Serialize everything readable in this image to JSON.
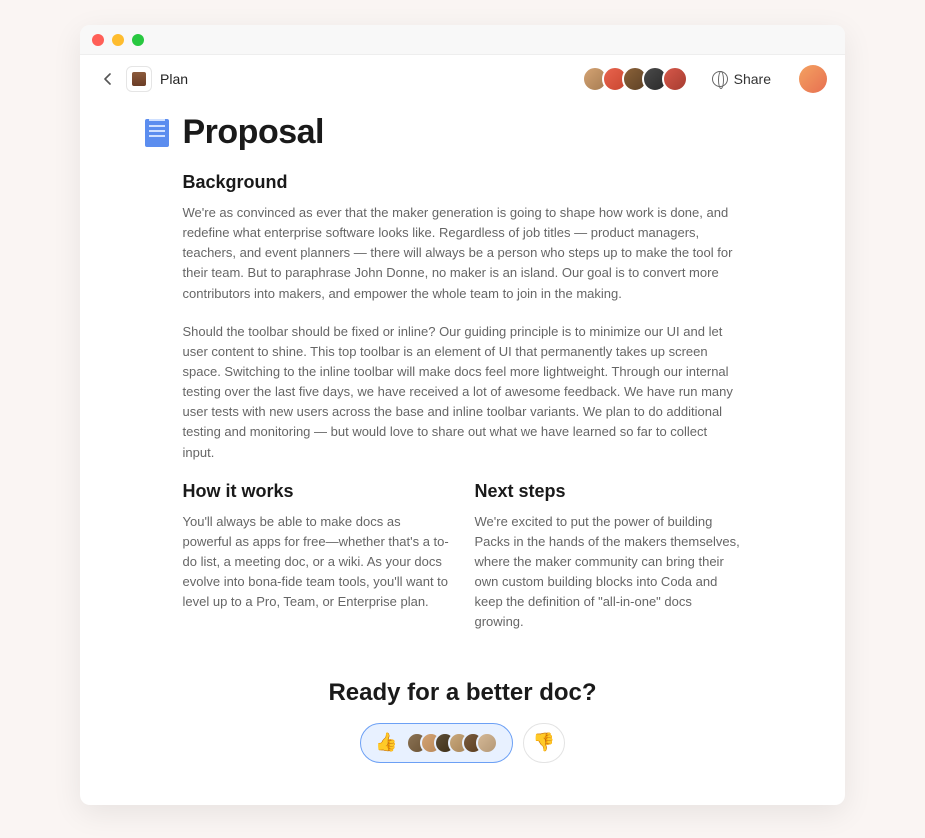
{
  "breadcrumb": {
    "label": "Plan"
  },
  "header": {
    "share_label": "Share",
    "collaborators": [
      {
        "bg": "linear-gradient(135deg,#d4a373,#a67c52)"
      },
      {
        "bg": "linear-gradient(135deg,#e8644e,#c94630)"
      },
      {
        "bg": "linear-gradient(135deg,#8b6239,#5d4125)"
      },
      {
        "bg": "linear-gradient(135deg,#4a4a4a,#2a2a2a)"
      },
      {
        "bg": "linear-gradient(135deg,#d6584a,#a63c30)"
      }
    ]
  },
  "document": {
    "title": "Proposal",
    "sections": {
      "background": {
        "heading": "Background",
        "para1": "We're as convinced as ever that the maker generation is going to shape how work is done, and redefine what enterprise software looks like. Regardless of job titles — product managers, teachers, and event planners — there will always be a person who steps up to make the tool for their team. But to paraphrase John Donne, no maker is an island. Our goal is to convert more contributors into makers, and empower the whole team to join in the making.",
        "para2": "Should the toolbar should be fixed or inline? Our guiding principle is to minimize our UI and let user content to shine. This top toolbar is an element of UI that permanently takes up screen space. Switching to the inline toolbar will make docs feel more lightweight. Through our internal testing over the last five days, we have received a lot of awesome feedback. We have run many user tests with new users across the base and inline toolbar variants. We plan to do additional testing and monitoring — but would love to share out what we have learned so far to collect input."
      },
      "how_it_works": {
        "heading": "How it works",
        "body": "You'll always be able to make docs as powerful as apps for free—whether that's a to-do list, a meeting doc, or a wiki. As your docs evolve into bona-fide team tools, you'll want to level up to a Pro, Team, or Enterprise plan."
      },
      "next_steps": {
        "heading": "Next steps",
        "body": "We're excited to put the power of building Packs in the hands of the makers themselves, where the maker community can bring their own custom building blocks into Coda and keep the definition of \"all-in-one\" docs growing."
      }
    },
    "cta": {
      "heading": "Ready for a better doc?",
      "up_emoji": "👍",
      "down_emoji": "👎",
      "voters": [
        {
          "bg": "linear-gradient(135deg,#8b7355,#6b5335)"
        },
        {
          "bg": "linear-gradient(135deg,#d4a373,#b8885a)"
        },
        {
          "bg": "linear-gradient(135deg,#5d4e37,#3d2e17)"
        },
        {
          "bg": "linear-gradient(135deg,#c9a87c,#a8865a)"
        },
        {
          "bg": "linear-gradient(135deg,#7a5c3e,#5a3c1e)"
        },
        {
          "bg": "linear-gradient(135deg,#d4b896,#b49876)"
        }
      ]
    }
  }
}
